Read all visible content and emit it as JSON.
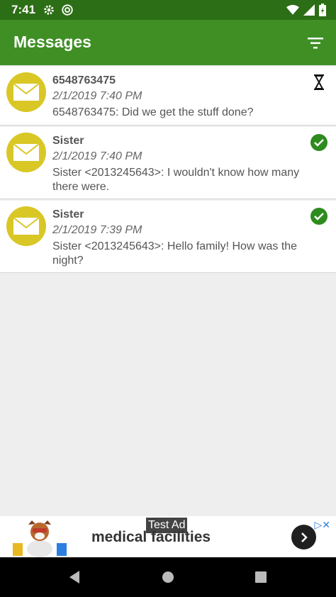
{
  "status_bar": {
    "time": "7:41"
  },
  "app_bar": {
    "title": "Messages",
    "filter_icon": "filter-icon"
  },
  "messages": [
    {
      "sender": "6548763475",
      "date": "2/1/2019 7:40 PM",
      "body": "6548763475: Did we get the stuff done?",
      "status": "hourglass-icon"
    },
    {
      "sender": "Sister",
      "date": "2/1/2019 7:40 PM",
      "body": "Sister <2013245643>: I wouldn't know how many there were.",
      "status": "check-circle-icon"
    },
    {
      "sender": "Sister",
      "date": "2/1/2019 7:39 PM",
      "body": "Sister <2013245643>: Hello family! How was the night?",
      "status": "check-circle-icon"
    }
  ],
  "ad": {
    "label": "Test Ad",
    "text": "medical facilities"
  },
  "colors": {
    "status_bar": "#2c6e16",
    "app_bar": "#3f8f25",
    "avatar": "#d9c726",
    "check": "#2e8b1e"
  }
}
